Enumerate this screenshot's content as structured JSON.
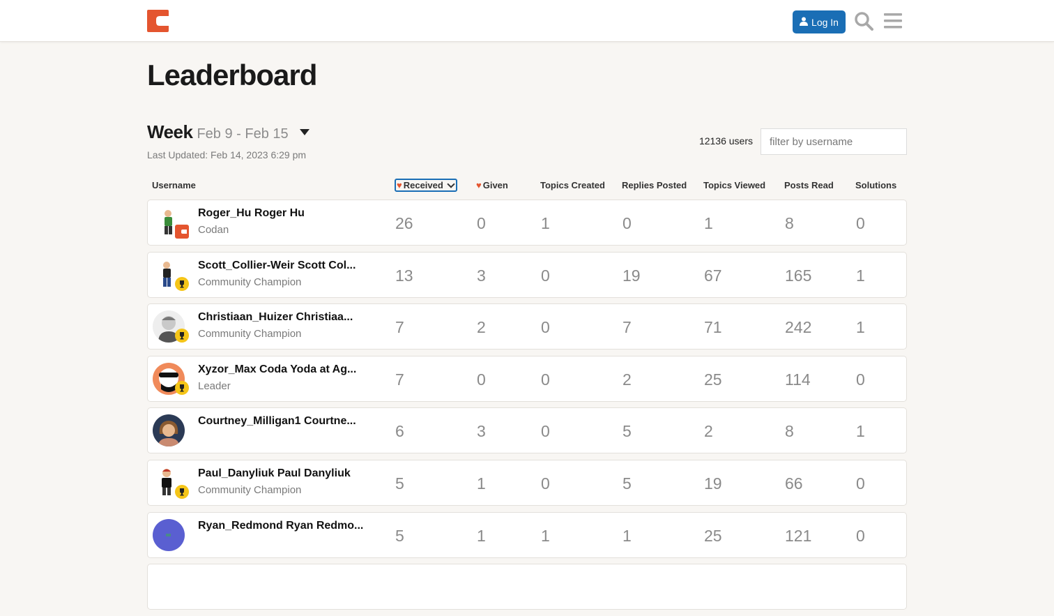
{
  "header": {
    "login_label": "Log In",
    "brand_color": "#e4552f",
    "button_color": "#1a6eb5"
  },
  "page": {
    "title": "Leaderboard",
    "period_label": "Week",
    "period_range": "Feb 9 - Feb 15",
    "last_updated": "Last Updated: Feb 14, 2023 6:29 pm",
    "user_count": "12136 users",
    "filter_placeholder": "filter by username"
  },
  "columns": {
    "username": "Username",
    "received": "Received",
    "given": "Given",
    "topics_created": "Topics Created",
    "replies_posted": "Replies Posted",
    "topics_viewed": "Topics Viewed",
    "posts_read": "Posts Read",
    "solutions": "Solutions"
  },
  "rows": [
    {
      "name": "Roger_Hu  Roger Hu",
      "title": "Codan",
      "badge": "codan-icon",
      "received": "26",
      "given": "0",
      "topics_created": "1",
      "replies_posted": "0",
      "topics_viewed": "1",
      "posts_read": "8",
      "solutions": "0"
    },
    {
      "name": "Scott_Collier-Weir  Scott Col...",
      "title": "Community Champion",
      "badge": "trophy-icon",
      "received": "13",
      "given": "3",
      "topics_created": "0",
      "replies_posted": "19",
      "topics_viewed": "67",
      "posts_read": "165",
      "solutions": "1"
    },
    {
      "name": "Christiaan_Huizer  Christiaa...",
      "title": "Community Champion",
      "badge": "trophy-icon",
      "received": "7",
      "given": "2",
      "topics_created": "0",
      "replies_posted": "7",
      "topics_viewed": "71",
      "posts_read": "242",
      "solutions": "1"
    },
    {
      "name": "Xyzor_Max  Coda Yoda at Ag...",
      "title": "Leader",
      "badge": "trophy-icon",
      "received": "7",
      "given": "0",
      "topics_created": "0",
      "replies_posted": "2",
      "topics_viewed": "25",
      "posts_read": "114",
      "solutions": "0"
    },
    {
      "name": "Courtney_Milligan1  Courtne...",
      "title": "",
      "badge": "",
      "received": "6",
      "given": "3",
      "topics_created": "0",
      "replies_posted": "5",
      "topics_viewed": "2",
      "posts_read": "8",
      "solutions": "1"
    },
    {
      "name": "Paul_Danyliuk  Paul Danyliuk",
      "title": "Community Champion",
      "badge": "trophy-icon",
      "received": "5",
      "given": "1",
      "topics_created": "0",
      "replies_posted": "5",
      "topics_viewed": "19",
      "posts_read": "66",
      "solutions": "0"
    },
    {
      "name": "Ryan_Redmond  Ryan Redmo...",
      "title": "",
      "badge": "",
      "received": "5",
      "given": "1",
      "topics_created": "1",
      "replies_posted": "1",
      "topics_viewed": "25",
      "posts_read": "121",
      "solutions": "0"
    }
  ]
}
